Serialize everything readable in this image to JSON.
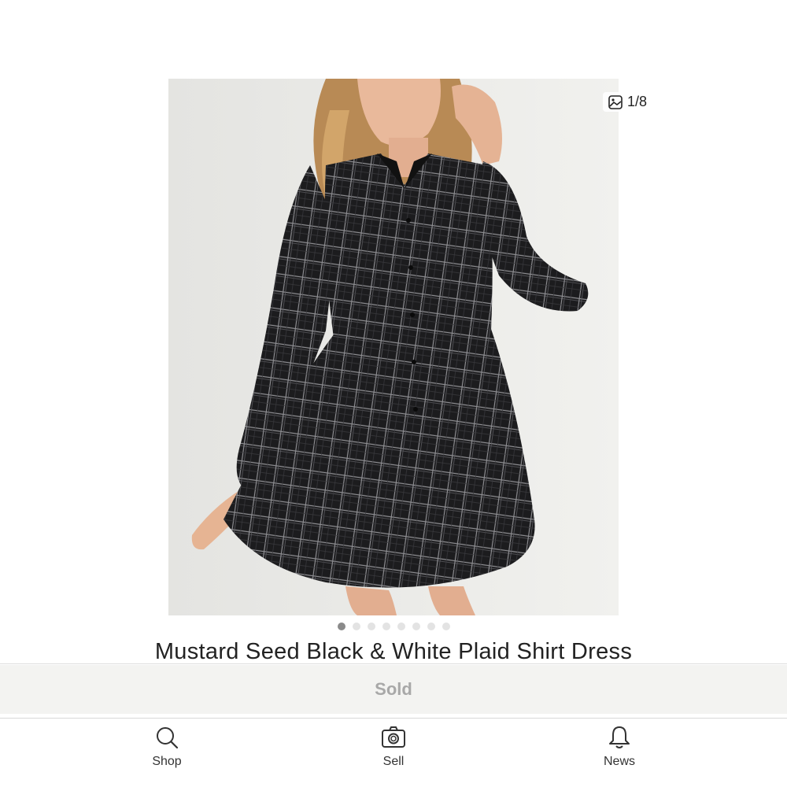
{
  "product": {
    "title": "Mustard Seed Black & White Plaid Shirt Dress",
    "status": "Sold"
  },
  "gallery": {
    "counter": "1/8",
    "counter_icon": "image-icon",
    "total_images": 8,
    "active_index": 0
  },
  "tabbar": {
    "shop": {
      "label": "Shop",
      "icon": "search-icon"
    },
    "sell": {
      "label": "Sell",
      "icon": "camera-icon"
    },
    "news": {
      "label": "News",
      "icon": "bell-icon"
    }
  },
  "colors": {
    "sold_bar": "#f3f3f1",
    "sold_text": "#a8a8a8",
    "dot_active": "#8a8a8a",
    "dot_inactive": "#e3e3e3"
  }
}
